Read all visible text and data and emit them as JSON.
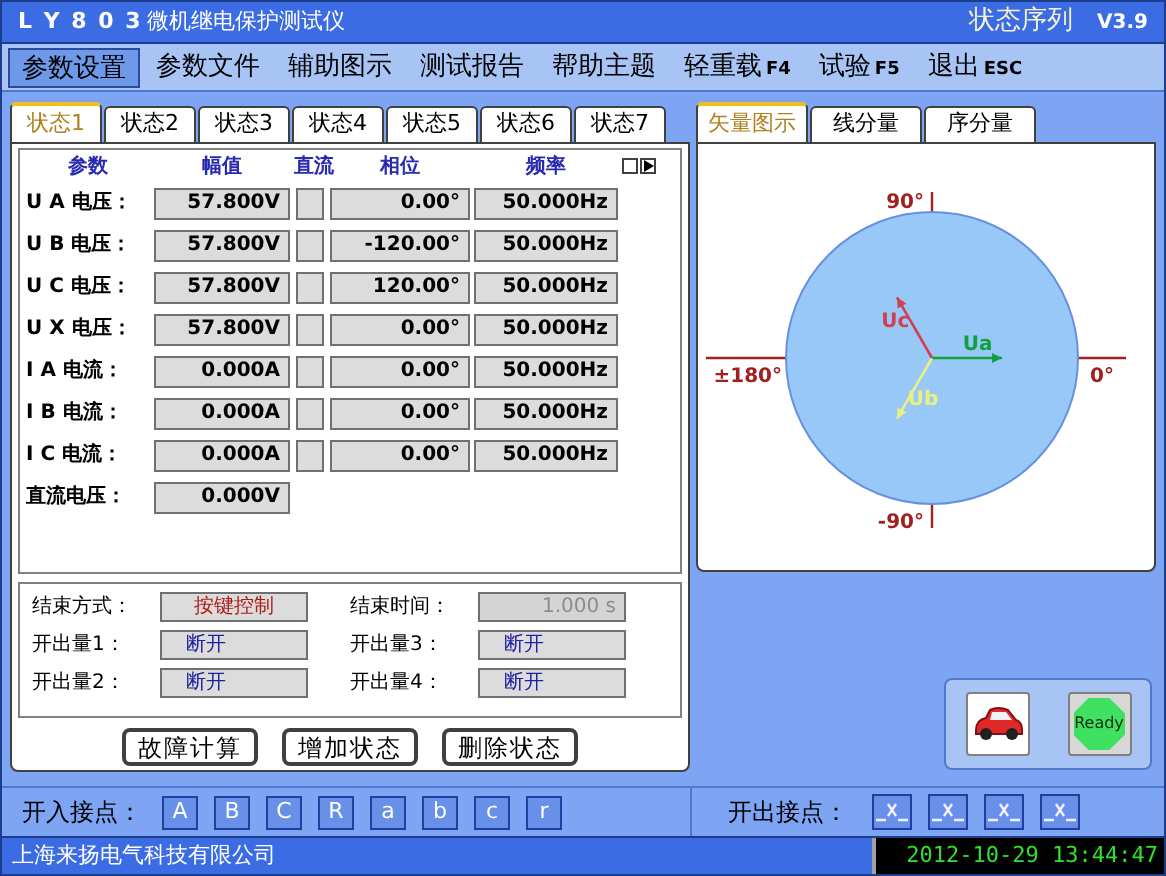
{
  "window": {
    "title": "L Y 8 0 3",
    "subtitle": "微机继电保护测试仪",
    "mode": "状态序列",
    "version": "V3.9"
  },
  "menu": [
    {
      "label": "参数设置",
      "selected": true
    },
    {
      "label": "参数文件",
      "selected": false
    },
    {
      "label": "辅助图示",
      "selected": false
    },
    {
      "label": "测试报告",
      "selected": false
    },
    {
      "label": "帮助主题",
      "selected": false
    },
    {
      "label": "轻重载",
      "key": "F4",
      "selected": false
    },
    {
      "label": "试验",
      "key": "F5",
      "selected": false
    },
    {
      "label": "退出",
      "key": "ESC",
      "selected": false
    }
  ],
  "state_tabs": [
    {
      "label": "状态1",
      "selected": true
    },
    {
      "label": "状态2",
      "selected": false
    },
    {
      "label": "状态3",
      "selected": false
    },
    {
      "label": "状态4",
      "selected": false
    },
    {
      "label": "状态5",
      "selected": false
    },
    {
      "label": "状态6",
      "selected": false
    },
    {
      "label": "状态7",
      "selected": false
    }
  ],
  "table": {
    "columns": [
      "参数",
      "幅值",
      "直流",
      "相位",
      "频率"
    ],
    "rows": [
      {
        "label": "U A 电压：",
        "amplitude": "57.800V",
        "dc": false,
        "phase": "0.00°",
        "frequency": "50.000Hz",
        "phasor": {
          "label": "Ua",
          "color": "#10a040"
        }
      },
      {
        "label": "U B 电压：",
        "amplitude": "57.800V",
        "dc": false,
        "phase": "-120.00°",
        "frequency": "50.000Hz",
        "phasor": {
          "label": "Ub",
          "color": "#e8f080"
        }
      },
      {
        "label": "U C 电压：",
        "amplitude": "57.800V",
        "dc": false,
        "phase": "120.00°",
        "frequency": "50.000Hz",
        "phasor": {
          "label": "Uc",
          "color": "#d04050"
        }
      },
      {
        "label": "U X 电压：",
        "amplitude": "57.800V",
        "dc": false,
        "phase": "0.00°",
        "frequency": "50.000Hz"
      },
      {
        "label": "I A 电流：",
        "amplitude": "0.000A",
        "dc": false,
        "phase": "0.00°",
        "frequency": "50.000Hz"
      },
      {
        "label": "I B 电流：",
        "amplitude": "0.000A",
        "dc": false,
        "phase": "0.00°",
        "frequency": "50.000Hz"
      },
      {
        "label": "I C 电流：",
        "amplitude": "0.000A",
        "dc": false,
        "phase": "0.00°",
        "frequency": "50.000Hz"
      }
    ],
    "dc_voltage": {
      "label": "直流电压：",
      "value": "0.000V"
    }
  },
  "settings": [
    {
      "label": "结束方式：",
      "value": "按键控制",
      "kind": "mode"
    },
    {
      "label": "结束时间：",
      "value": "1.000 s",
      "kind": "time",
      "disabled": true
    },
    {
      "label": "开出量1：",
      "value": "断开",
      "kind": "output"
    },
    {
      "label": "开出量3：",
      "value": "断开",
      "kind": "output"
    },
    {
      "label": "开出量2：",
      "value": "断开",
      "kind": "output"
    },
    {
      "label": "开出量4：",
      "value": "断开",
      "kind": "output"
    }
  ],
  "buttons": [
    "故障计算",
    "增加状态",
    "删除状态"
  ],
  "view_tabs": [
    {
      "label": "矢量图示",
      "selected": true
    },
    {
      "label": "线分量",
      "selected": false
    },
    {
      "label": "序分量",
      "selected": false
    }
  ],
  "vector_diagram": {
    "axis_labels": [
      "90°",
      "0°",
      "-90°",
      "±180°"
    ]
  },
  "tools": [
    {
      "kind": "car"
    },
    {
      "kind": "ready",
      "label": "Ready"
    }
  ],
  "binary_inputs": {
    "label": "开入接点：",
    "keys": [
      "A",
      "B",
      "C",
      "R",
      "a",
      "b",
      "c",
      "r"
    ]
  },
  "binary_outputs": {
    "label": "开出接点：",
    "contacts": [
      {
        "closed": false
      },
      {
        "closed": false
      },
      {
        "closed": false
      },
      {
        "closed": false
      }
    ]
  },
  "status_bar": {
    "company": "上海来扬电气科技有限公司",
    "datetime": "2012-10-29 13:44:47"
  }
}
